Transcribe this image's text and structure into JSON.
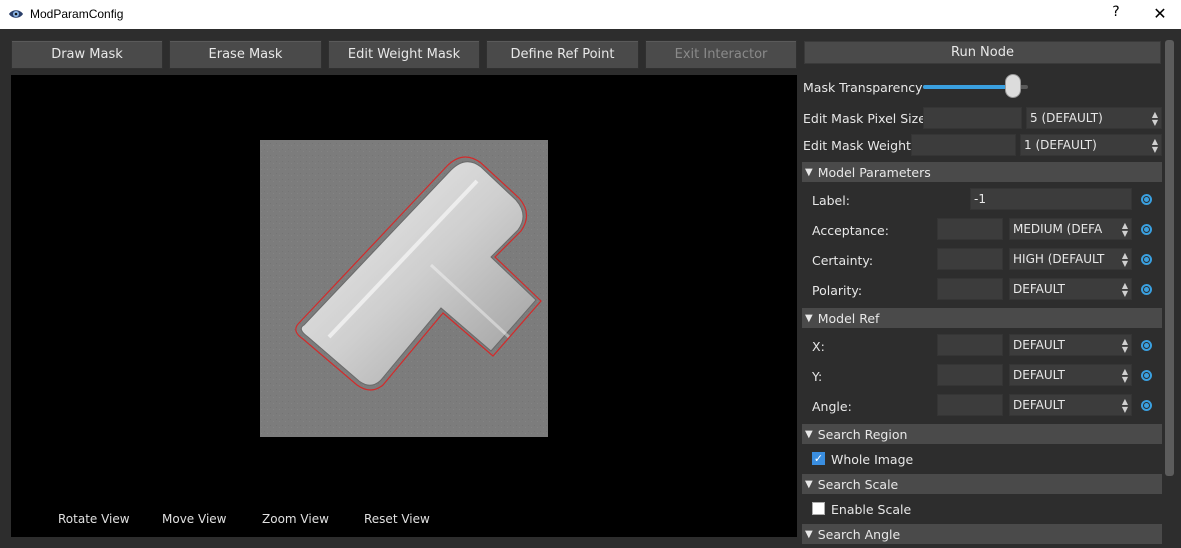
{
  "window": {
    "title": "ModParamConfig",
    "help": "?",
    "close": "✕"
  },
  "toolbar": {
    "draw_mask": "Draw Mask",
    "erase_mask": "Erase Mask",
    "edit_weight_mask": "Edit Weight Mask",
    "define_ref_point": "Define Ref Point",
    "exit_interactor": "Exit Interactor"
  },
  "viewer": {
    "tools": [
      "Rotate View",
      "Move View",
      "Zoom View",
      "Reset View"
    ]
  },
  "panel": {
    "run_node": "Run Node",
    "mask_transparency": {
      "label": "Mask Transparency",
      "value": 0.86
    },
    "edit_mask_pixel_size": {
      "label": "Edit Mask Pixel Size",
      "input": "",
      "select": "5 (DEFAULT)"
    },
    "edit_mask_weight": {
      "label": "Edit Mask Weight",
      "input": "",
      "select": "1 (DEFAULT)"
    },
    "model_parameters": {
      "title": "Model Parameters",
      "label": {
        "label": "Label:",
        "value": "-1"
      },
      "acceptance": {
        "label": "Acceptance:",
        "input": "",
        "select": "MEDIUM (DEFA"
      },
      "certainty": {
        "label": "Certainty:",
        "input": "",
        "select": "HIGH (DEFAULT"
      },
      "polarity": {
        "label": "Polarity:",
        "input": "",
        "select": "DEFAULT"
      }
    },
    "model_ref": {
      "title": "Model Ref",
      "x": {
        "label": "X:",
        "input": "",
        "select": "DEFAULT"
      },
      "y": {
        "label": "Y:",
        "input": "",
        "select": "DEFAULT"
      },
      "angle": {
        "label": "Angle:",
        "input": "",
        "select": "DEFAULT"
      }
    },
    "search_region": {
      "title": "Search Region",
      "whole_image": {
        "label": "Whole Image",
        "checked": true
      }
    },
    "search_scale": {
      "title": "Search Scale",
      "enable_scale": {
        "label": "Enable Scale",
        "checked": false
      }
    },
    "search_angle": {
      "title": "Search Angle"
    }
  }
}
